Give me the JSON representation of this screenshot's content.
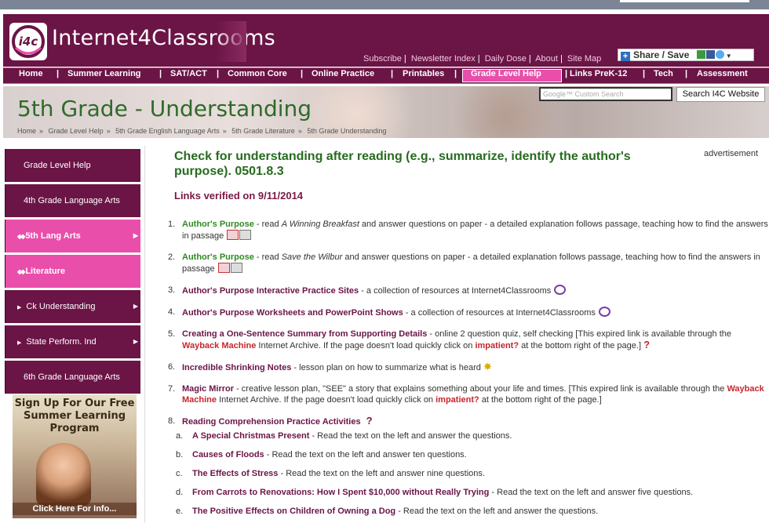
{
  "site": {
    "logo_text": "Internet4Classrooms",
    "logo_mark": "i4c",
    "top_links": [
      "Subscribe",
      "Newsletter Index",
      "Daily Dose",
      "About",
      "Site Map"
    ],
    "share_label": "Share / Save"
  },
  "nav": {
    "items": [
      "Home",
      "Summer Learning",
      "SAT/ACT",
      "Common Core",
      "Online Practice",
      "Printables",
      "Grade Level Help",
      "Links PreK-12",
      "Tech",
      "Assessment"
    ],
    "active": "Grade Level Help"
  },
  "banner": {
    "title_a": "5th Grade",
    "title_dash": " - ",
    "title_b": "Understanding",
    "search_placeholder": "Google™ Custom Search",
    "search_button": "Search I4C Website",
    "breadcrumb": [
      "Home",
      "Grade Level Help",
      "5th Grade English Language Arts",
      "5th Grade Literature",
      "5th Grade Understanding"
    ]
  },
  "sidebar": {
    "items": [
      {
        "label": "Grade Level Help",
        "style": "dark"
      },
      {
        "label": "4th Grade Language Arts",
        "style": "dark"
      },
      {
        "label": "5th Lang Arts",
        "style": "pink"
      },
      {
        "label": "Literature",
        "style": "pink"
      },
      {
        "label": "Ck Understanding",
        "style": "dark"
      },
      {
        "label": "State Perform. Ind",
        "style": "dark"
      },
      {
        "label": "6th Grade Language Arts",
        "style": "dark"
      }
    ],
    "promo_title": "Sign Up For Our Free Summer Learning Program",
    "promo_button": "Click Here For Info..."
  },
  "main": {
    "title": "Check for understanding after reading (e.g., summarize, identify the author's purpose). 0501.8.3",
    "verified": "Links verified on 9/11/2014",
    "ad_label": "advertisement",
    "resources": [
      {
        "n": "1.",
        "link": "Author's Purpose",
        "pre": " - read ",
        "em": "A Winning Breakfast",
        "post": " and answer questions on paper - a detailed explanation follows passage, teaching how to find the answers in passage"
      },
      {
        "n": "2.",
        "link": "Author's Purpose",
        "pre": " - read ",
        "em": "Save the Wilbur",
        "post": " and answer questions on paper - a detailed explanation follows passage, teaching how to find the answers in passage"
      },
      {
        "n": "3.",
        "link": "Author's Purpose Interactive Practice Sites",
        "text": " - a collection of resources at Internet4Classrooms"
      },
      {
        "n": "4.",
        "link": "Author's Purpose Worksheets and PowerPoint Shows",
        "text": " - a collection of resources at Internet4Classrooms"
      },
      {
        "n": "5.",
        "link": "Creating a One-Sentence Summary from Supporting Details",
        "text": " - online 2 question quiz, self checking [This expired link is available through the ",
        "wayback": "Wayback Machine",
        "text2": " Internet Archive. If the page doesn't load quickly click on ",
        "impatient": "impatient?",
        "text3": " at the bottom right of the page.]"
      },
      {
        "n": "6.",
        "link": "Incredible Shrinking Notes",
        "text": " - lesson plan on how to summarize what is heard"
      },
      {
        "n": "7.",
        "link": "Magic Mirror",
        "text": " - creative lesson plan, \"SEE\" a story that explains something about your life and times. [This expired link is available through the ",
        "wayback": "Wayback Machine",
        "text2": " Internet Archive. If the page doesn't load quickly click on ",
        "impatient": "impatient?",
        "text3": " at the bottom right of the page.]"
      },
      {
        "n": "8.",
        "link": "Reading Comprehension Practice Activities"
      }
    ],
    "sub_activities": [
      {
        "n": "a.",
        "link": "A Special Christmas Present",
        "text": " - Read the text on the left and answer the questions."
      },
      {
        "n": "b.",
        "link": "Causes of Floods",
        "text": " - Read the text on the left and answer ten questions."
      },
      {
        "n": "c.",
        "link": "The Effects of Stress",
        "text": " - Read the text on the left and answer nine questions."
      },
      {
        "n": "d.",
        "link": "From Carrots to Renovations: How I Spent $10,000 without Really Trying",
        "text": " - Read the text on the left and answer five questions."
      },
      {
        "n": "e.",
        "link": "The Positive Effects on Children of Owning a Dog",
        "text": " - Read the text on the left and answer the questions."
      }
    ]
  },
  "colors": {
    "brand": "#6b1446",
    "pink": "#e94eaa",
    "green": "#276b1f",
    "link_red": "#c8262c"
  }
}
